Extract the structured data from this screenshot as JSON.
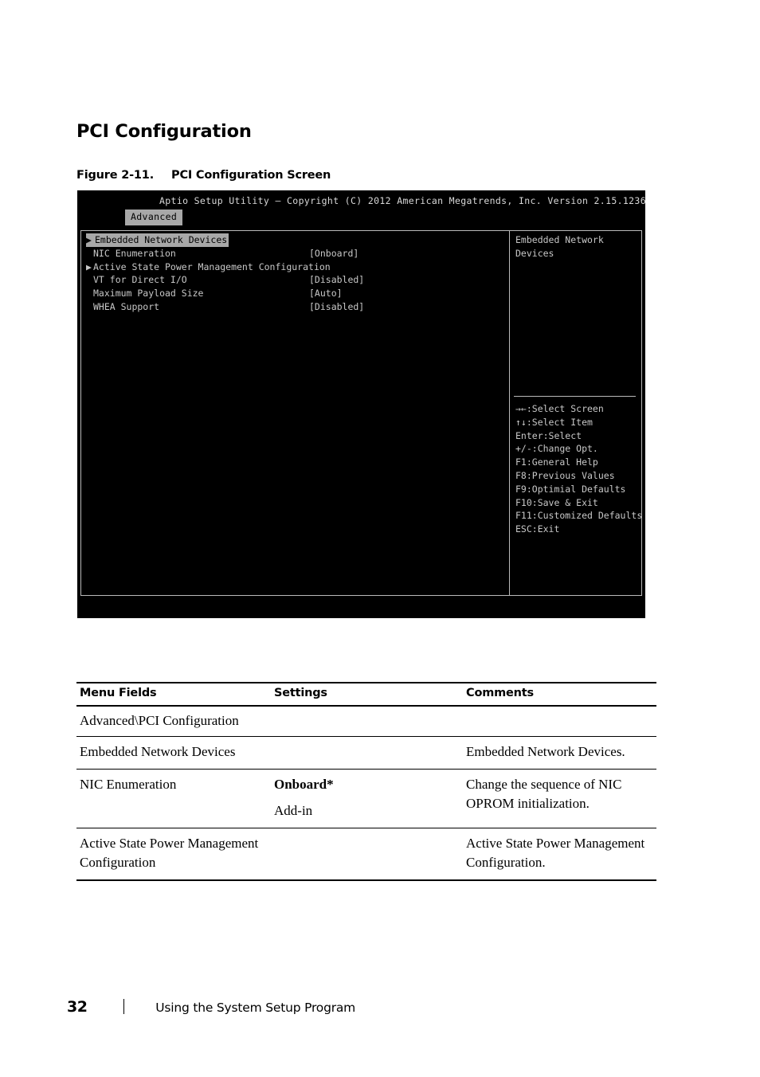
{
  "document": {
    "heading": "PCI Configuration",
    "figure": {
      "number": "Figure 2-11.",
      "title": "PCI Configuration Screen"
    },
    "footer": {
      "page_number": "32",
      "section_label": "Using the System Setup Program"
    }
  },
  "bios": {
    "titlebar": "Aptio Setup Utility – Copyright (C) 2012 American Megatrends, Inc.  Version 2.15.1236",
    "tabs": [
      {
        "label": "Advanced",
        "selected": true
      }
    ],
    "menu_items": [
      {
        "arrow": "▶",
        "label": "Embedded Network Devices",
        "value": "",
        "selected": true,
        "submenu": true
      },
      {
        "arrow": "",
        "label": "NIC Enumeration",
        "value": "[Onboard]",
        "selected": false,
        "submenu": false
      },
      {
        "arrow": "▶",
        "label": "Active State Power Management Configuration",
        "value": "",
        "selected": false,
        "submenu": true
      },
      {
        "arrow": "",
        "label": "VT for Direct I/O",
        "value": "[Disabled]",
        "selected": false,
        "submenu": false
      },
      {
        "arrow": "",
        "label": "Maximum Payload Size",
        "value": "[Auto]",
        "selected": false,
        "submenu": false
      },
      {
        "arrow": "",
        "label": "WHEA Support",
        "value": "[Disabled]",
        "selected": false,
        "submenu": false
      }
    ],
    "help_panel": {
      "description_lines": [
        "Embedded Network",
        "Devices"
      ],
      "key_legend": [
        "→←:Select Screen",
        "↑↓:Select Item",
        "Enter:Select",
        "+/-:Change Opt.",
        "F1:General Help",
        "F8:Previous Values",
        "F9:Optimial Defaults",
        "F10:Save & Exit",
        "F11:Customized Defaults",
        "ESC:Exit"
      ]
    },
    "colors": {
      "background": "#000000",
      "text": "#c8c8c8",
      "highlight_bg": "#a8a8a8",
      "highlight_text": "#000000",
      "border": "#b9b9b9"
    }
  },
  "table": {
    "headers": {
      "field": "Menu Fields",
      "settings": "Settings",
      "comments": "Comments"
    },
    "section": "Advanced\\PCI Configuration",
    "rows": [
      {
        "field": "Embedded Network Devices",
        "setting_primary": "",
        "setting_alt": "",
        "comment": "Embedded Network Devices."
      },
      {
        "field": "NIC Enumeration",
        "setting_primary": "Onboard*",
        "setting_alt": "Add-in",
        "comment": "Change the sequence of NIC OPROM initialization."
      },
      {
        "field": "Active State Power Management Configuration",
        "setting_primary": "",
        "setting_alt": "",
        "comment": "Active State Power Management Configuration."
      }
    ]
  }
}
